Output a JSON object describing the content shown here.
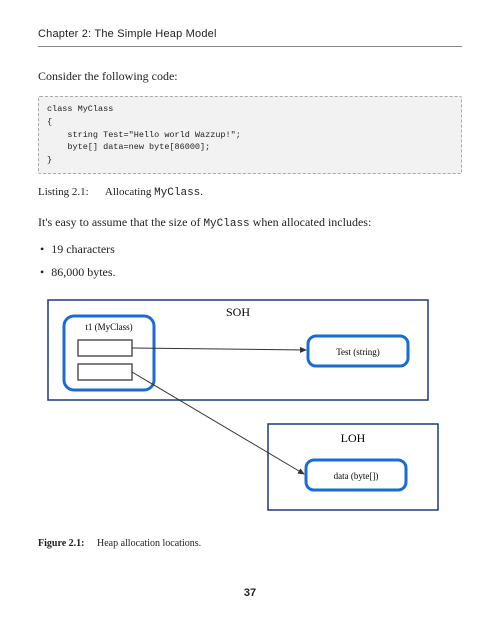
{
  "header": {
    "chapter_title": "Chapter 2: The Simple Heap Model"
  },
  "intro_para": "Consider the following code:",
  "code": "class MyClass\n{\n    string Test=\"Hello world Wazzup!\";\n    byte[] data=new byte[86000];\n}",
  "listing": {
    "label": "Listing 2.1:",
    "caption_prefix": "Allocating ",
    "caption_code": "MyClass",
    "caption_suffix": "."
  },
  "assume_line_prefix": "It's easy to assume that the size of ",
  "assume_line_code": "MyClass",
  "assume_line_suffix": " when allocated includes:",
  "bullets": [
    "19 characters",
    "86,000 bytes."
  ],
  "diagram": {
    "soh_label": "SOH",
    "loh_label": "LOH",
    "t1_label": "t1 (MyClass)",
    "test_label": "Test (string)",
    "data_label": "data (byte[])"
  },
  "figure": {
    "label": "Figure 2.1:",
    "caption": "Heap allocation locations."
  },
  "page_number": "37"
}
